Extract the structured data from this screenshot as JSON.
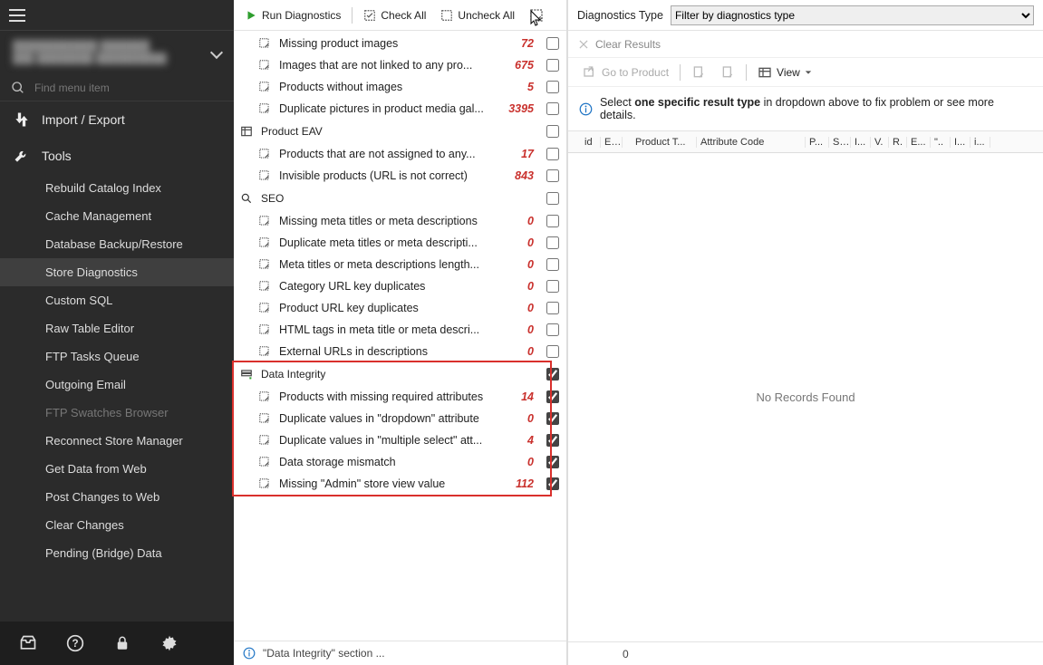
{
  "sidebar": {
    "search_placeholder": "Find menu item",
    "store_text_line1": "████████████ ███████",
    "store_text_line2": "███ ████████ ██████████",
    "sections": [
      {
        "label": "Import / Export",
        "items": []
      },
      {
        "label": "Tools",
        "items": [
          {
            "label": "Rebuild Catalog Index"
          },
          {
            "label": "Cache Management"
          },
          {
            "label": "Database Backup/Restore"
          },
          {
            "label": "Store Diagnostics",
            "active": true
          },
          {
            "label": "Custom SQL"
          },
          {
            "label": "Raw Table Editor"
          },
          {
            "label": "FTP Tasks Queue"
          },
          {
            "label": "Outgoing Email"
          },
          {
            "label": "FTP Swatches Browser",
            "disabled": true
          },
          {
            "label": "Reconnect Store Manager"
          },
          {
            "label": "Get Data from Web"
          },
          {
            "label": "Post Changes to Web"
          },
          {
            "label": "Clear Changes"
          },
          {
            "label": "Pending (Bridge) Data"
          }
        ]
      }
    ]
  },
  "toolbar": {
    "run_label": "Run Diagnostics",
    "check_all_label": "Check All",
    "uncheck_all_label": "Uncheck All"
  },
  "tree": [
    {
      "type": "row",
      "label": "Missing product images",
      "count": "72",
      "checked": false
    },
    {
      "type": "row",
      "label": "Images that are not linked to any pro...",
      "count": "675",
      "checked": false
    },
    {
      "type": "row",
      "label": "Products without images",
      "count": "5",
      "checked": false
    },
    {
      "type": "row",
      "label": "Duplicate pictures in product media gal...",
      "count": "3395",
      "checked": false
    },
    {
      "type": "group",
      "label": "Product  EAV",
      "checked": false
    },
    {
      "type": "row",
      "label": "Products that are not assigned to any...",
      "count": "17",
      "checked": false
    },
    {
      "type": "row",
      "label": "Invisible products (URL is not correct)",
      "count": "843",
      "checked": false
    },
    {
      "type": "group",
      "label": "SEO",
      "checked": false
    },
    {
      "type": "row",
      "label": "Missing meta titles or meta descriptions",
      "count": "0",
      "checked": false
    },
    {
      "type": "row",
      "label": "Duplicate meta titles or meta descripti...",
      "count": "0",
      "checked": false
    },
    {
      "type": "row",
      "label": "Meta titles or meta descriptions length...",
      "count": "0",
      "checked": false
    },
    {
      "type": "row",
      "label": "Category URL key duplicates",
      "count": "0",
      "checked": false
    },
    {
      "type": "row",
      "label": "Product URL key duplicates",
      "count": "0",
      "checked": false
    },
    {
      "type": "row",
      "label": "HTML tags in meta title or meta descri...",
      "count": "0",
      "checked": false
    },
    {
      "type": "row",
      "label": "External URLs in descriptions",
      "count": "0",
      "checked": false
    },
    {
      "type": "group",
      "label": "Data Integrity",
      "checked": true
    },
    {
      "type": "row",
      "label": "Products with missing required attributes",
      "count": "14",
      "checked": true
    },
    {
      "type": "row",
      "label": "Duplicate values in \"dropdown\" attribute",
      "count": "0",
      "checked": true
    },
    {
      "type": "row",
      "label": "Duplicate values in \"multiple select\" att...",
      "count": "4",
      "checked": true
    },
    {
      "type": "row",
      "label": "Data storage mismatch",
      "count": "0",
      "checked": true
    },
    {
      "type": "row",
      "label": "Missing \"Admin\" store view value",
      "count": "112",
      "checked": true
    }
  ],
  "footer_hint": "\"Data Integrity\" section ...",
  "right": {
    "type_label": "Diagnostics Type",
    "type_placeholder": "Filter by diagnostics type",
    "clear_label": "Clear Results",
    "goto_label": "Go to Product",
    "view_label": "View",
    "info_prefix": "Select ",
    "info_bold": "one specific result type",
    "info_suffix": " in dropdown above to fix problem or see more details.",
    "columns": [
      "",
      "id",
      "E...",
      "",
      "Product T...",
      "Attribute Code",
      "P...",
      "S...",
      "I...",
      "V.",
      "R.",
      "E...",
      "\"..",
      "I...",
      "i..."
    ],
    "empty_text": "No Records Found",
    "footer_count": "0"
  }
}
